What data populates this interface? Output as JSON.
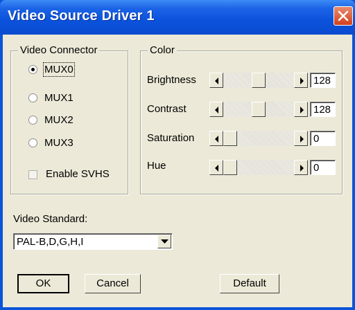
{
  "window": {
    "title": "Video Source Driver 1"
  },
  "connector": {
    "label": "Video Connector",
    "options": [
      "MUX0",
      "MUX1",
      "MUX2",
      "MUX3"
    ],
    "selected": "MUX0",
    "svhs_label": "Enable SVHS",
    "svhs_checked": false,
    "svhs_enabled": false
  },
  "color": {
    "label": "Color",
    "sliders": [
      {
        "label": "Brightness",
        "value": "128"
      },
      {
        "label": "Contrast",
        "value": "128"
      },
      {
        "label": "Saturation",
        "value": "0"
      },
      {
        "label": "Hue",
        "value": "0"
      }
    ]
  },
  "standard": {
    "label": "Video Standard:",
    "value": "PAL-B,D,G,H,I"
  },
  "buttons": {
    "ok": "OK",
    "cancel": "Cancel",
    "default": "Default"
  }
}
